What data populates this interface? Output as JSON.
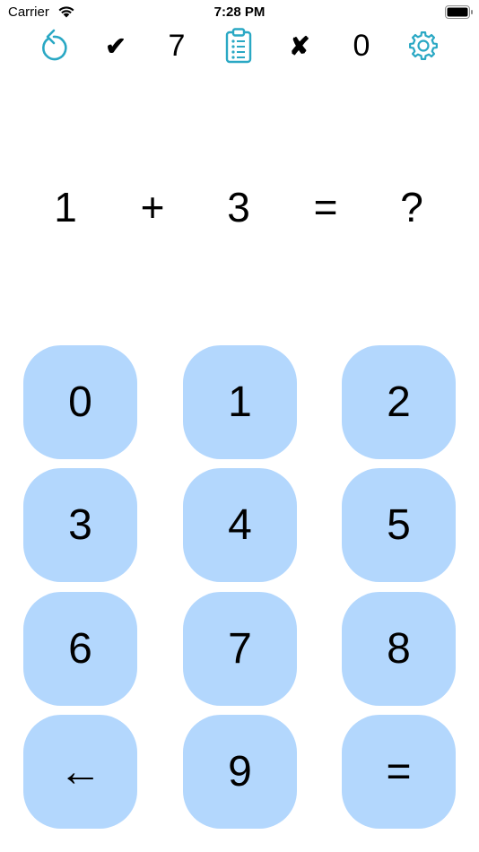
{
  "status_bar": {
    "carrier": "Carrier",
    "time": "7:28 PM"
  },
  "toolbar": {
    "reset_icon": "counterclockwise-arrow-icon",
    "correct_mark": "✔",
    "correct_count": "7",
    "history_icon": "clipboard-list-icon",
    "wrong_mark": "✘",
    "wrong_count": "0",
    "settings_icon": "gear-icon",
    "accent_color": "#2aa8c4"
  },
  "equation": {
    "operand1": "1",
    "operator": "+",
    "operand2": "3",
    "equals": "=",
    "answer": "?"
  },
  "keypad": {
    "key_color": "#b3d7fd",
    "keys": [
      "0",
      "1",
      "2",
      "3",
      "4",
      "5",
      "6",
      "7",
      "8",
      "←",
      "9",
      "="
    ]
  }
}
